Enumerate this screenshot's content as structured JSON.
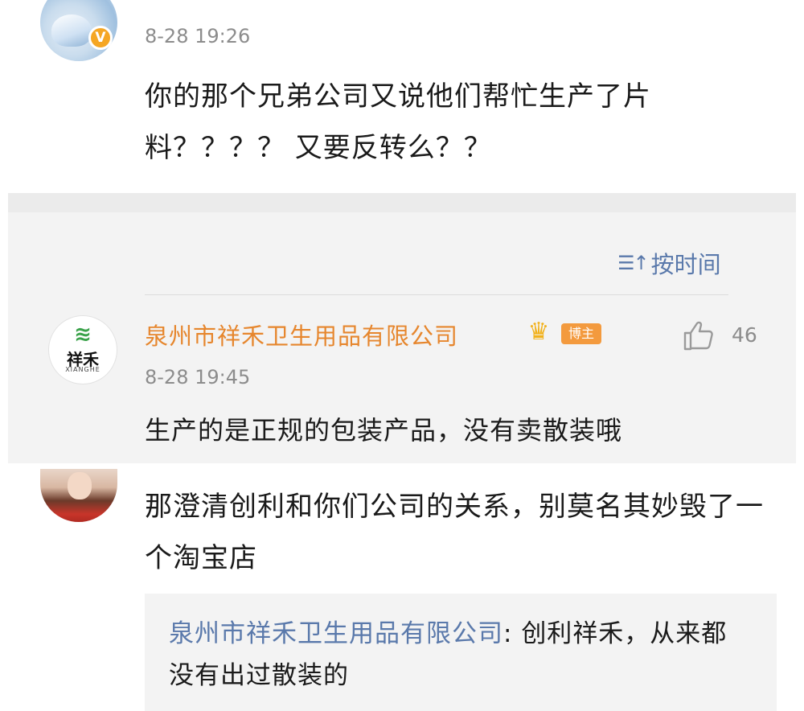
{
  "comment1": {
    "verified_badge": "V",
    "time": "8-28 19:26",
    "text": "你的那个兄弟公司又说他们帮忙生产了片料？？？？ 又要反转么？？"
  },
  "replies": {
    "sort_icon": "sort-icon",
    "sort_label": "按时间",
    "reply": {
      "logo_cn": "祥禾",
      "logo_en": "XIANGHE",
      "author": "泉州市祥禾卫生用品有限公司",
      "badge": "博主",
      "like_count": "46",
      "time": "8-28 19:45",
      "text": "生产的是正规的包装产品，没有卖散装哦"
    }
  },
  "comment2": {
    "text": "那澄清创利和你们公司的关系，别莫名其妙毁了一个淘宝店",
    "quote": {
      "name": "泉州市祥禾卫生用品有限公司",
      "sep": ": ",
      "text": "创利祥禾，从来都没有出过散装的"
    }
  },
  "colors": {
    "author_orange": "#e6862d",
    "link_blue": "#5a79ab",
    "muted": "#8c8c8c",
    "band_bg": "#f3f3f3"
  }
}
